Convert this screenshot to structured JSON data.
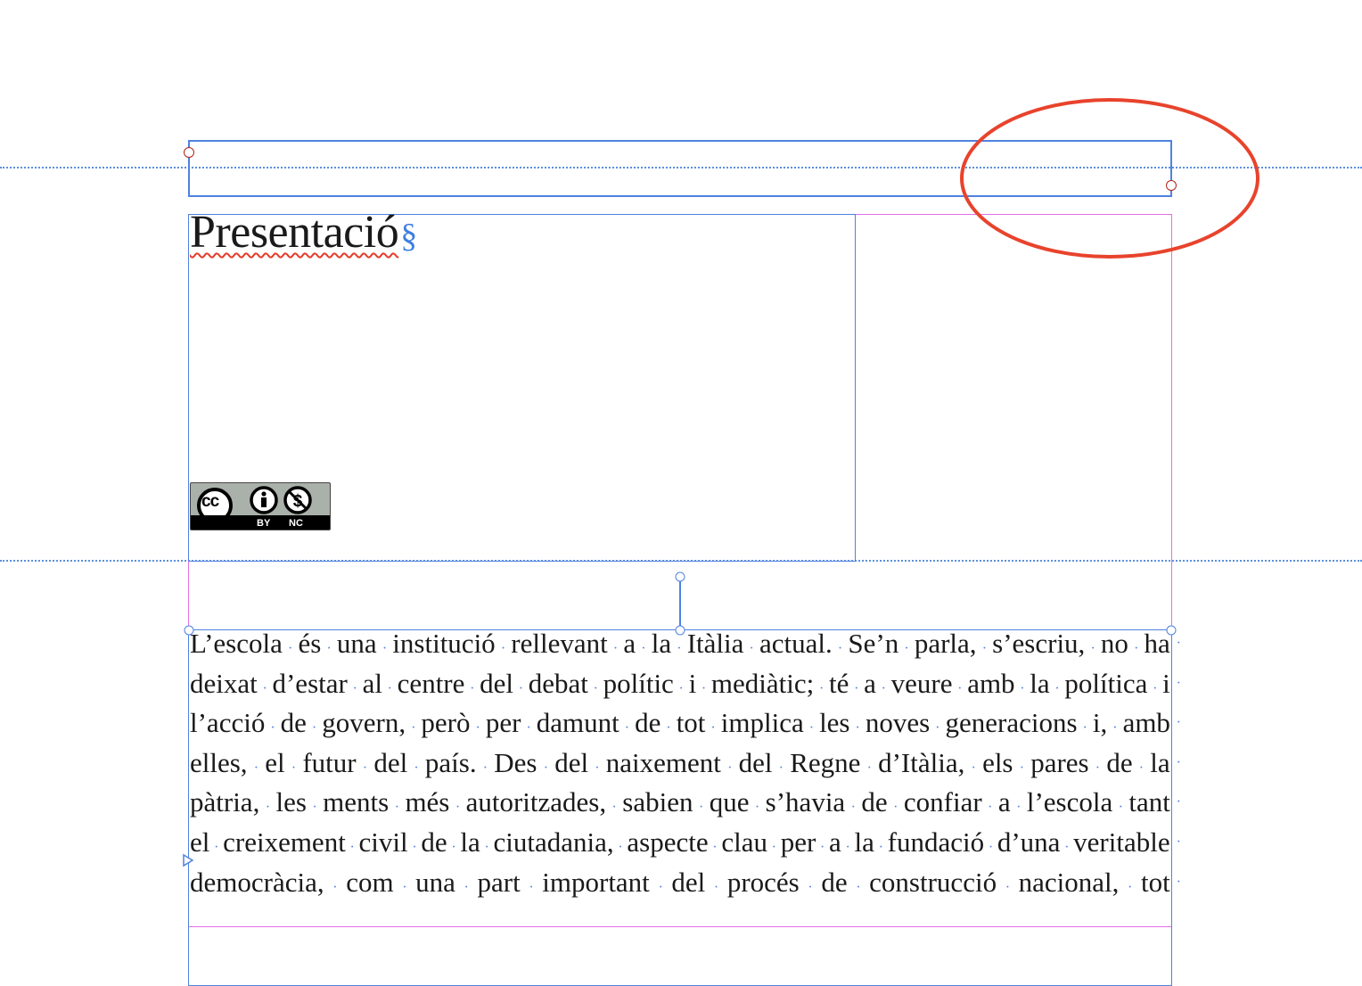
{
  "heading": {
    "text": "Presentació",
    "pilcrow": "§"
  },
  "license_badge": {
    "cc": "cc",
    "by": "BY",
    "nc": "NC"
  },
  "body_lines": [
    "L’escola és una institució rellevant a la Itàlia actual. Se’n parla, s’escriu, no ha",
    "deixat d’estar al centre del debat polític i mediàtic; té a veure amb la política i",
    "l’acció de govern, però per damunt de tot implica les noves generacions i, amb",
    "elles, el futur del país. Des del naixement del Regne d’Itàlia, els pares de la",
    "pàtria, les ments més autoritzades, sabien que s’havia de confiar a l’escola tant",
    "el creixement civil de la ciutadania, aspecte clau per a la fundació d’una veritable",
    "democràcia, com una part important del procés de construcció nacional, tot"
  ],
  "colors": {
    "frame": "#4f82e0",
    "margin": "#e26ee8",
    "annotation": "#e8432c",
    "spellcheck": "#e53b2a"
  }
}
